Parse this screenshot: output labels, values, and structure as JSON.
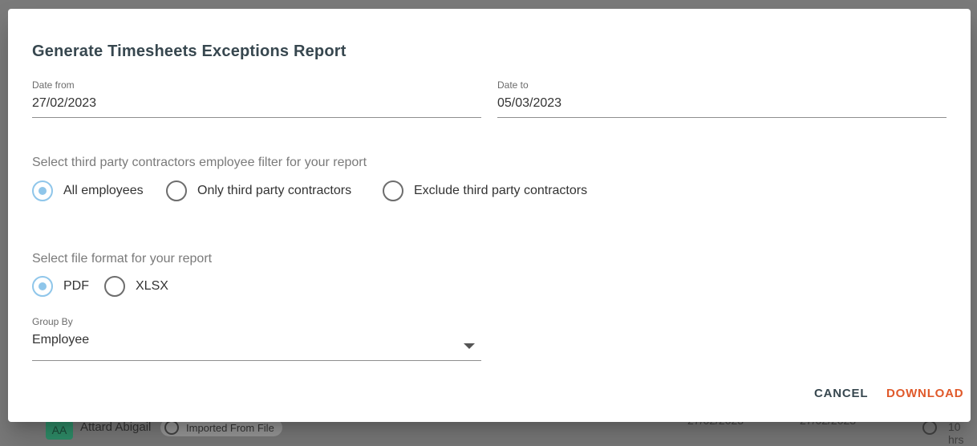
{
  "background": {
    "avatar_initials": "AA",
    "employee_name": "Attard Abigail",
    "chip_label": "Imported From File",
    "date_a": "27/02/2023",
    "date_b": "27/02/2023",
    "hours": "10 hrs"
  },
  "dialog": {
    "title": "Generate Timesheets Exceptions Report",
    "date_from": {
      "label": "Date from",
      "value": "27/02/2023"
    },
    "date_to": {
      "label": "Date to",
      "value": "05/03/2023"
    },
    "contractor_filter": {
      "label": "Select third party contractors employee filter for your report",
      "options": [
        "All employees",
        "Only third party contractors",
        "Exclude third party contractors"
      ],
      "selected": "All employees"
    },
    "file_format": {
      "label": "Select file format for your report",
      "options": [
        "PDF",
        "XLSX"
      ],
      "selected": "PDF"
    },
    "group_by": {
      "label": "Group By",
      "value": "Employee"
    },
    "actions": {
      "cancel": "CANCEL",
      "download": "DOWNLOAD"
    }
  },
  "colors": {
    "radio_selected": "#8fc6ea",
    "cancel_text": "#37474f",
    "download_text": "#e0592a"
  }
}
